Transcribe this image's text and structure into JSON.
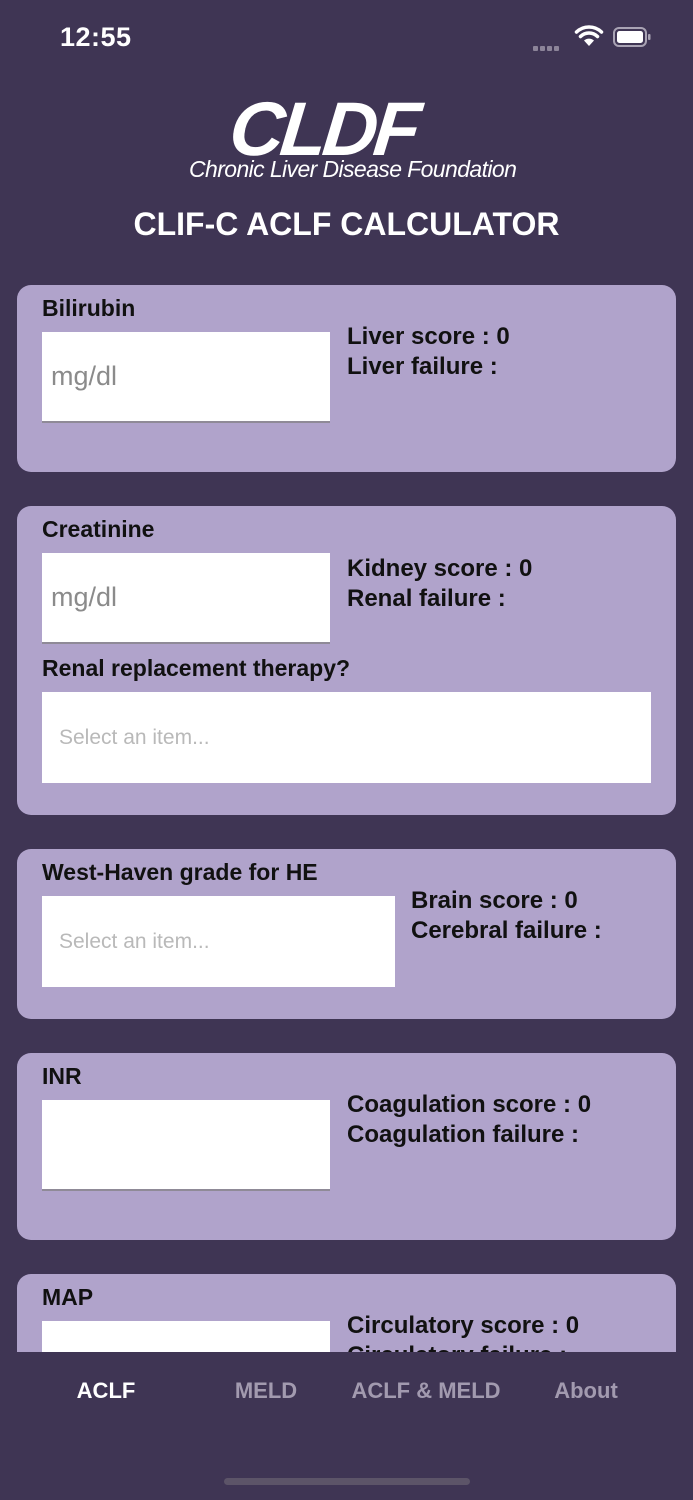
{
  "status": {
    "time": "12:55"
  },
  "header": {
    "logo_text": "CLDF",
    "logo_subtitle": "Chronic Liver Disease Foundation",
    "title": "CLIF-C ACLF CALCULATOR"
  },
  "cards": {
    "bilirubin": {
      "label": "Bilirubin",
      "placeholder": "mg/dl",
      "score": "Liver score : 0",
      "failure": "Liver failure :"
    },
    "creatinine": {
      "label": "Creatinine",
      "placeholder": "mg/dl",
      "score": "Kidney score : 0",
      "failure": "Renal failure :",
      "rrt_label": "Renal replacement therapy?",
      "rrt_placeholder": "Select an item..."
    },
    "west_haven": {
      "label": "West-Haven grade for HE",
      "placeholder": "Select an item...",
      "score": "Brain score : 0",
      "failure": "Cerebral failure :"
    },
    "inr": {
      "label": "INR",
      "score": "Coagulation score : 0",
      "failure": "Coagulation failure :"
    },
    "map": {
      "label": "MAP",
      "score": "Circulatory score : 0",
      "failure": "Circulatory failure :"
    }
  },
  "tabs": [
    {
      "label": "ACLF",
      "active": true
    },
    {
      "label": "MELD",
      "active": false
    },
    {
      "label": "ACLF & MELD",
      "active": false
    },
    {
      "label": "About",
      "active": false
    }
  ],
  "colors": {
    "background": "#3f3554",
    "card": "#b0a3cb",
    "tab_active": "#ffffff",
    "tab_inactive": "#a29aaf"
  }
}
